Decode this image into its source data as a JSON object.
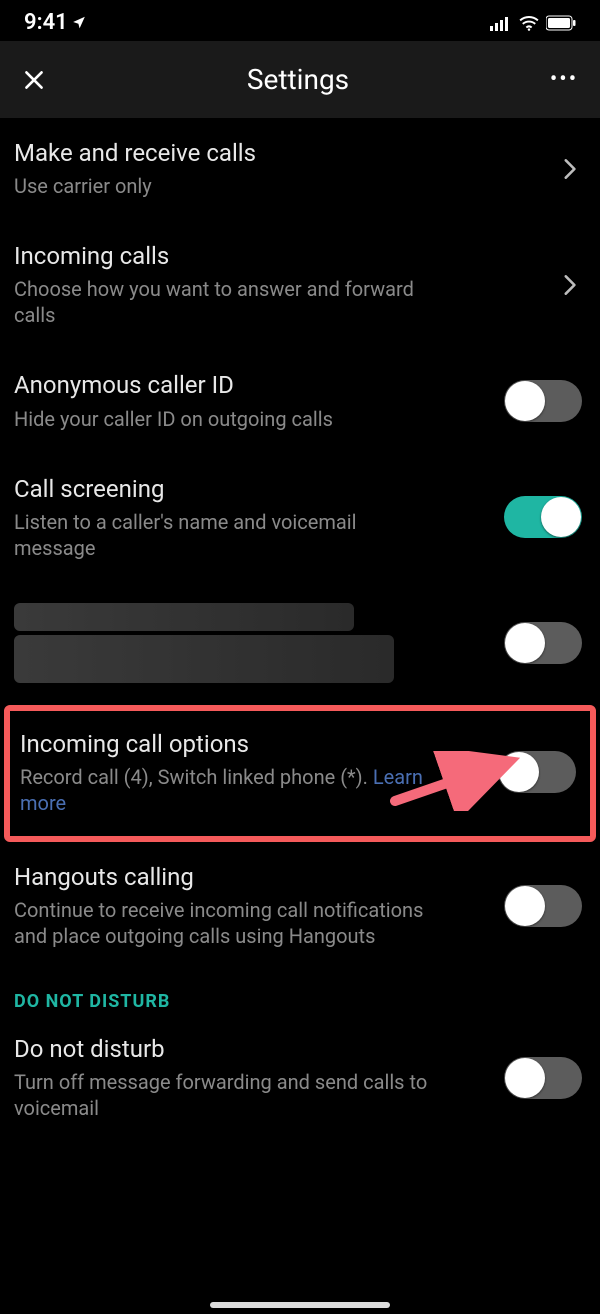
{
  "status": {
    "time": "9:41"
  },
  "header": {
    "title": "Settings"
  },
  "rows": {
    "make_calls": {
      "title": "Make and receive calls",
      "sub": "Use carrier only"
    },
    "incoming": {
      "title": "Incoming calls",
      "sub": "Choose how you want to answer and forward calls"
    },
    "anon_id": {
      "title": "Anonymous caller ID",
      "sub": "Hide your caller ID on outgoing calls",
      "on": false
    },
    "screening": {
      "title": "Call screening",
      "sub": "Listen to a caller's name and voicemail message",
      "on": true
    },
    "redacted": {
      "on": false
    },
    "incoming_opt": {
      "title": "Incoming call options",
      "sub": "Record call (4), Switch linked phone (*). ",
      "sub_link": "Learn more",
      "on": false
    },
    "hangouts": {
      "title": "Hangouts calling",
      "sub": "Continue to receive incoming call notifications and place outgoing calls using Hangouts",
      "on": false
    },
    "dnd": {
      "title": "Do not disturb",
      "sub": "Turn off message forwarding and send calls to voicemail",
      "on": false
    }
  },
  "section": {
    "dnd": "DO NOT DISTURB"
  }
}
